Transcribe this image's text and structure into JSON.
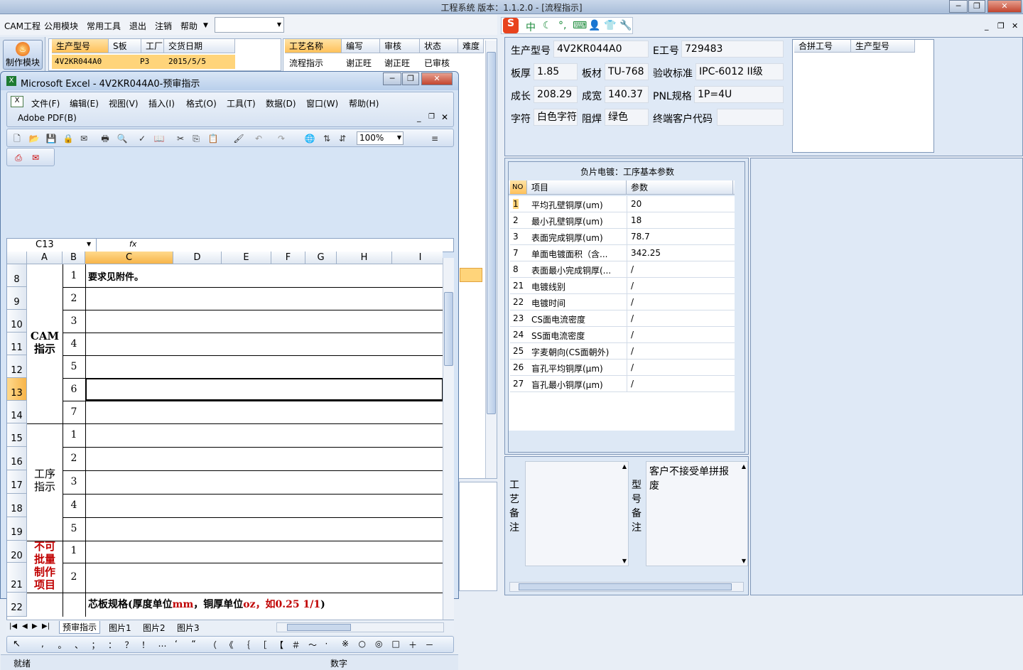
{
  "app": {
    "title": "工程系统   版本：1.1.2.0 - [流程指示]"
  },
  "menu": {
    "items": [
      "CAM工程",
      "公用模块",
      "常用工具",
      "退出",
      "注销",
      "帮助"
    ],
    "dropdown_value": ""
  },
  "ime": {
    "glyphs": [
      "S",
      "中",
      "☾",
      "°,",
      "⌨",
      "👤",
      "👕",
      "🔧"
    ]
  },
  "nav": {
    "make_button": "制作模块"
  },
  "order_grid": {
    "headers": [
      "生产型号",
      "S板",
      "工厂",
      "交货日期"
    ],
    "row": [
      "4V2KR044A0",
      "",
      "P3",
      "2015/5/5"
    ]
  },
  "process_grid": {
    "headers": [
      "工艺名称",
      "编写",
      "审核",
      "状态",
      "难度"
    ],
    "row": [
      "流程指示",
      "谢正旺",
      "谢正旺",
      "已审核",
      ""
    ]
  },
  "excel": {
    "title": "Microsoft Excel - 4V2KR044A0-预审指示",
    "menu": [
      "文件(F)",
      "编辑(E)",
      "视图(V)",
      "插入(I)",
      "格式(O)",
      "工具(T)",
      "数据(D)",
      "窗口(W)",
      "帮助(H)"
    ],
    "pdf_menu": "Adobe PDF(B)",
    "zoom": "100%",
    "namebox": "C13",
    "fx": "fx",
    "columns": [
      "A",
      "B",
      "C",
      "D",
      "E",
      "F",
      "G",
      "H",
      "I"
    ],
    "rows": [
      "8",
      "9",
      "10",
      "11",
      "12",
      "13",
      "14",
      "15",
      "16",
      "17",
      "18",
      "19",
      "20",
      "21",
      "22"
    ],
    "b_numbers": [
      "1",
      "2",
      "3",
      "4",
      "5",
      "6",
      "7",
      "1",
      "2",
      "3",
      "4",
      "5",
      "1",
      "2"
    ],
    "group_cam": "CAM\n指示",
    "group_process": "工序\n指示",
    "group_noproduce": "不可\n批量\n制作\n项目",
    "cell_c8": "要求见附件。",
    "cell_c22_a": "芯板规格(厚度单位",
    "cell_c22_b": "mm",
    "cell_c22_c": "，铜厚单位",
    "cell_c22_d": "oz",
    "cell_c22_e": "，如0.25 1/1",
    "cell_c22_f": ")",
    "sheet_tabs": [
      "预审指示",
      "图片1",
      "图片2",
      "图片3"
    ],
    "draw_symbols": [
      ",",
      "。",
      "、",
      "；",
      "：",
      "？",
      "！",
      "…",
      "‘",
      "“",
      "（",
      "《",
      "｛",
      "［",
      "【",
      "＃",
      "～",
      "·",
      "※",
      "○",
      "◎",
      "□",
      "＋",
      "－"
    ],
    "status_ready": "就绪",
    "status_num": "数字"
  },
  "info": {
    "model_label": "生产型号",
    "model_value": "4V2KR044A0",
    "e_label": "E工号",
    "e_value": "729483",
    "thick_label": "板厚",
    "thick_value": "1.85",
    "mat_label": "板材",
    "mat_value": "TU-768",
    "std_label": "验收标准",
    "std_value": "IPC-6012 II级",
    "len_label": "成长",
    "len_value": "208.29",
    "wid_label": "成宽",
    "wid_value": "140.37",
    "pnl_label": "PNL规格",
    "pnl_value": "1P=4U",
    "char_label": "字符",
    "char_value": "白色字符",
    "mask_label": "阻焊",
    "mask_value": "绿色",
    "cust_label": "终端客户代码",
    "cust_value": ""
  },
  "merge_grid": {
    "headers": [
      "合拼工号",
      "生产型号"
    ]
  },
  "params": {
    "title": "负片电镀：工序基本参数",
    "headers": [
      "NO",
      "项目",
      "参数"
    ],
    "rows": [
      {
        "no": "1",
        "item": "平均孔壁铜厚(um)",
        "val": "20"
      },
      {
        "no": "2",
        "item": "最小孔壁铜厚(um)",
        "val": "18"
      },
      {
        "no": "3",
        "item": "表面完成铜厚(um)",
        "val": "78.7"
      },
      {
        "no": "7",
        "item": "单面电镀面积（含...",
        "val": "342.25"
      },
      {
        "no": "8",
        "item": "表面最小完成铜厚(...",
        "val": "/"
      },
      {
        "no": "21",
        "item": "电镀线别",
        "val": "/"
      },
      {
        "no": "22",
        "item": "电镀时间",
        "val": "/"
      },
      {
        "no": "23",
        "item": "CS面电流密度",
        "val": "/"
      },
      {
        "no": "24",
        "item": "SS面电流密度",
        "val": "/"
      },
      {
        "no": "25",
        "item": "字麦朝向(CS面朝外)",
        "val": "/"
      },
      {
        "no": "26",
        "item": "盲孔平均铜厚(μm)",
        "val": "/"
      },
      {
        "no": "27",
        "item": "盲孔最小铜厚(μm)",
        "val": "/"
      }
    ]
  },
  "notes": {
    "process_label": "工艺备注",
    "model_label": "型号备注",
    "model_text": "客户不接受单拼报废"
  }
}
